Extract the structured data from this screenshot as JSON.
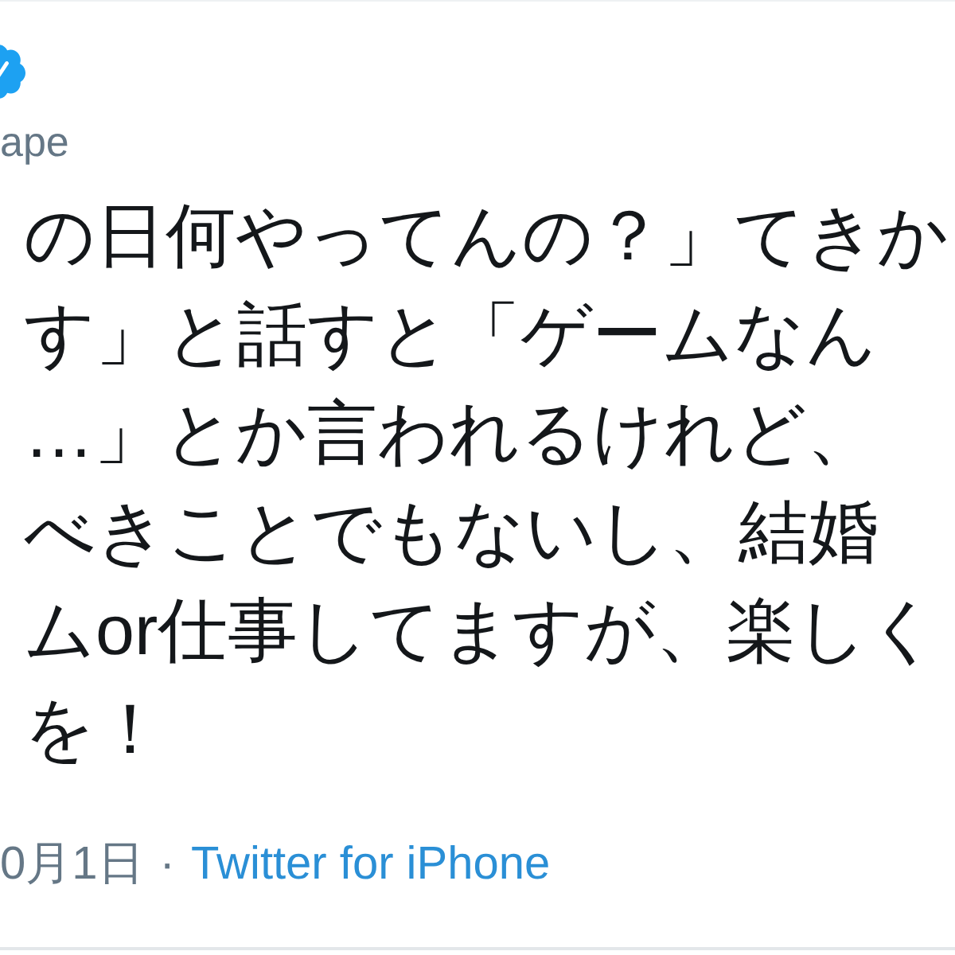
{
  "header": {
    "verified": true,
    "handle": "ape"
  },
  "tweet": {
    "lines": [
      "の日何やってんの？」てきか",
      "す」と話すと「ゲームなん",
      "…」とか言われるけれど、",
      "べきことでもないし、結婚",
      "ムor仕事してますが、楽しく",
      "を！"
    ]
  },
  "footer": {
    "date": "0月1日",
    "separator": "·",
    "source": "Twitter for iPhone"
  }
}
